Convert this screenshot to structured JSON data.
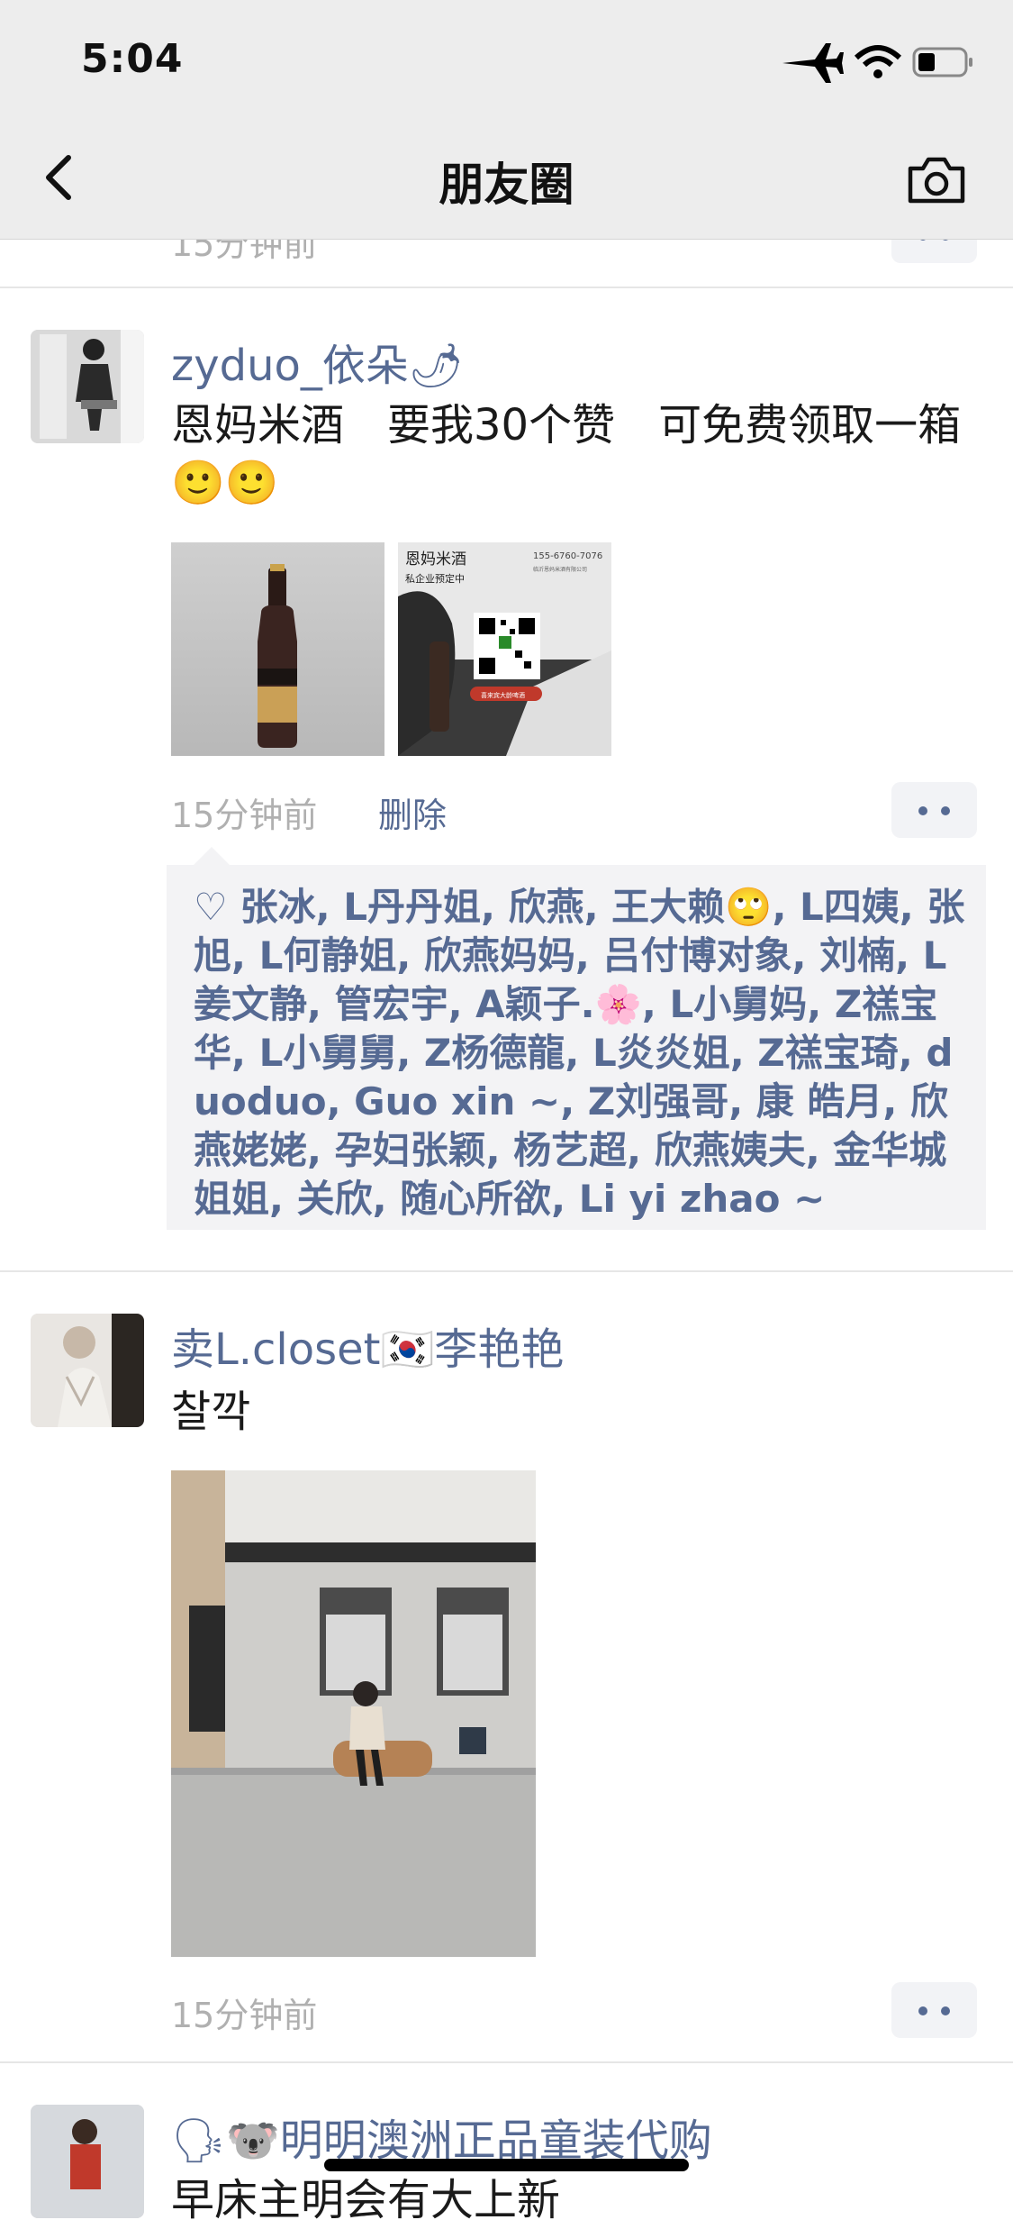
{
  "status_bar": {
    "time": "5:04"
  },
  "header": {
    "title": "朋友圈"
  },
  "prev_post": {
    "timestamp": "15分钟前"
  },
  "posts": [
    {
      "author": "zyduo_依朵🌶",
      "text": "恩妈米酒　要我30个赞　可免费领取一箱🙂🙂",
      "timestamp": "15分钟前",
      "delete_label": "删除",
      "likes": "张冰, L丹丹姐, 欣燕, 王大赖🙄, L四姨, 张旭, L何静姐, 欣燕妈妈, 吕付博对象, 刘楠, L姜文静, 管宏宇, A颖子.🌸, L小舅妈, Z禚宝华, L小舅舅, Z杨德龍, L炎炎姐, Z禚宝琦, duoduo, Guo xin ~, Z刘强哥, 康 皓月, 欣燕姥姥, 孕妇张颖, 杨艺超, 欣燕姨夫, 金华城姐姐, 关欣, 随心所欲, Li yi zhao ~",
      "photo2_lines": [
        "恩妈米酒",
        "私企业预定中",
        "155-6760-7076",
        "临沂恩妈米酒有限公司",
        "喜来宾大龄啤酒"
      ]
    },
    {
      "author": "卖L.closet🇰🇷李艳艳",
      "text": "찰깍",
      "timestamp": "15分钟前"
    },
    {
      "author": "🗣🐨明明澳洲正品童装代购",
      "text": "早床主明会有大上新"
    }
  ]
}
